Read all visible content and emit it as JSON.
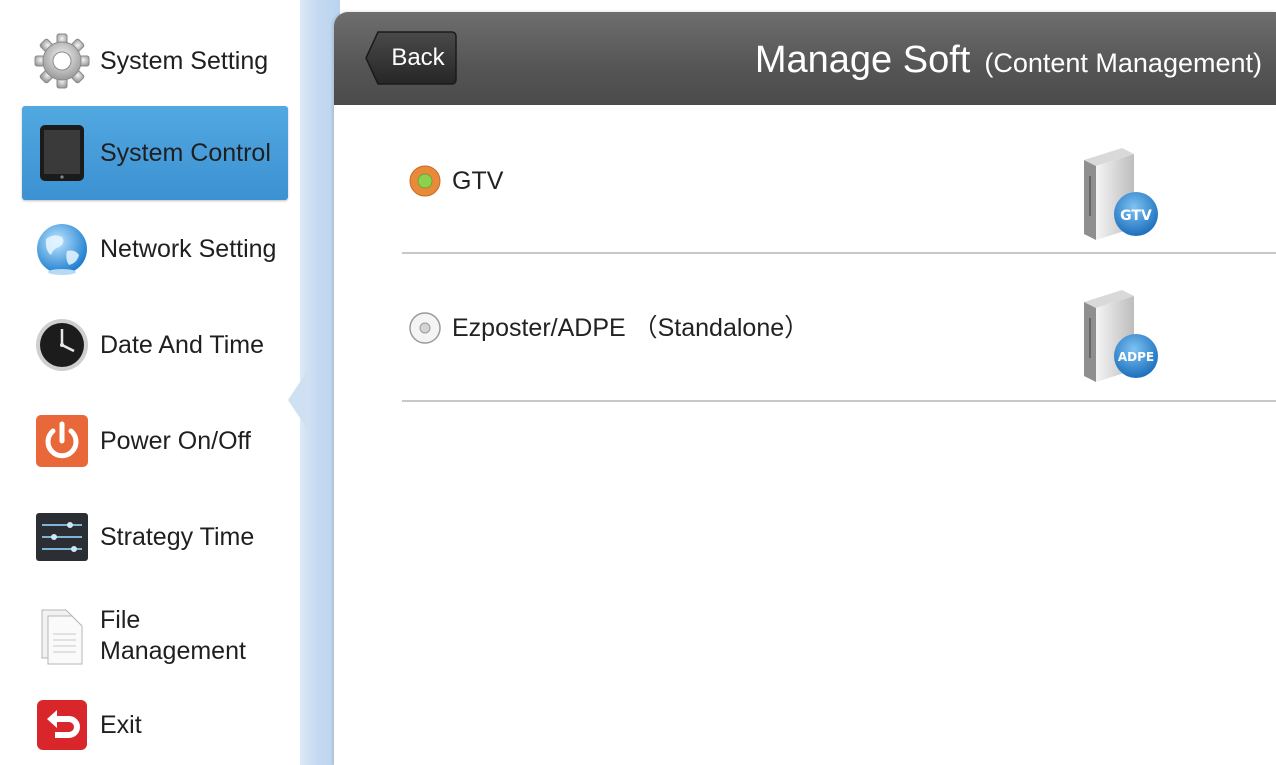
{
  "sidebar": {
    "items": [
      {
        "label": "System Setting",
        "icon": "gear-icon",
        "selected": false
      },
      {
        "label": "System Control",
        "icon": "tablet-icon",
        "selected": true
      },
      {
        "label": "Network Setting",
        "icon": "globe-icon",
        "selected": false
      },
      {
        "label": "Date And Time",
        "icon": "clock-icon",
        "selected": false
      },
      {
        "label": "Power On/Off",
        "icon": "power-icon",
        "selected": false
      },
      {
        "label": "Strategy Time",
        "icon": "sliders-icon",
        "selected": false
      },
      {
        "label": "File\nManagement",
        "icon": "document-icon",
        "selected": false
      },
      {
        "label": "Exit",
        "icon": "exit-icon",
        "selected": false
      }
    ]
  },
  "header": {
    "back_label": "Back",
    "title": "Manage Soft",
    "subtitle": "(Content Management)"
  },
  "options": [
    {
      "label": "GTV",
      "selected": true,
      "badge": "GTV",
      "icon": "server-gtv-icon"
    },
    {
      "label": "Ezposter/ADPE （Standalone）",
      "selected": false,
      "badge": "ADPE",
      "icon": "server-adpe-icon"
    }
  ],
  "colors": {
    "selected_menu": "#3c91d2",
    "header_bg": "#555555",
    "radio_selected": "#e88a3a",
    "radio_dot": "#8fd14f"
  }
}
